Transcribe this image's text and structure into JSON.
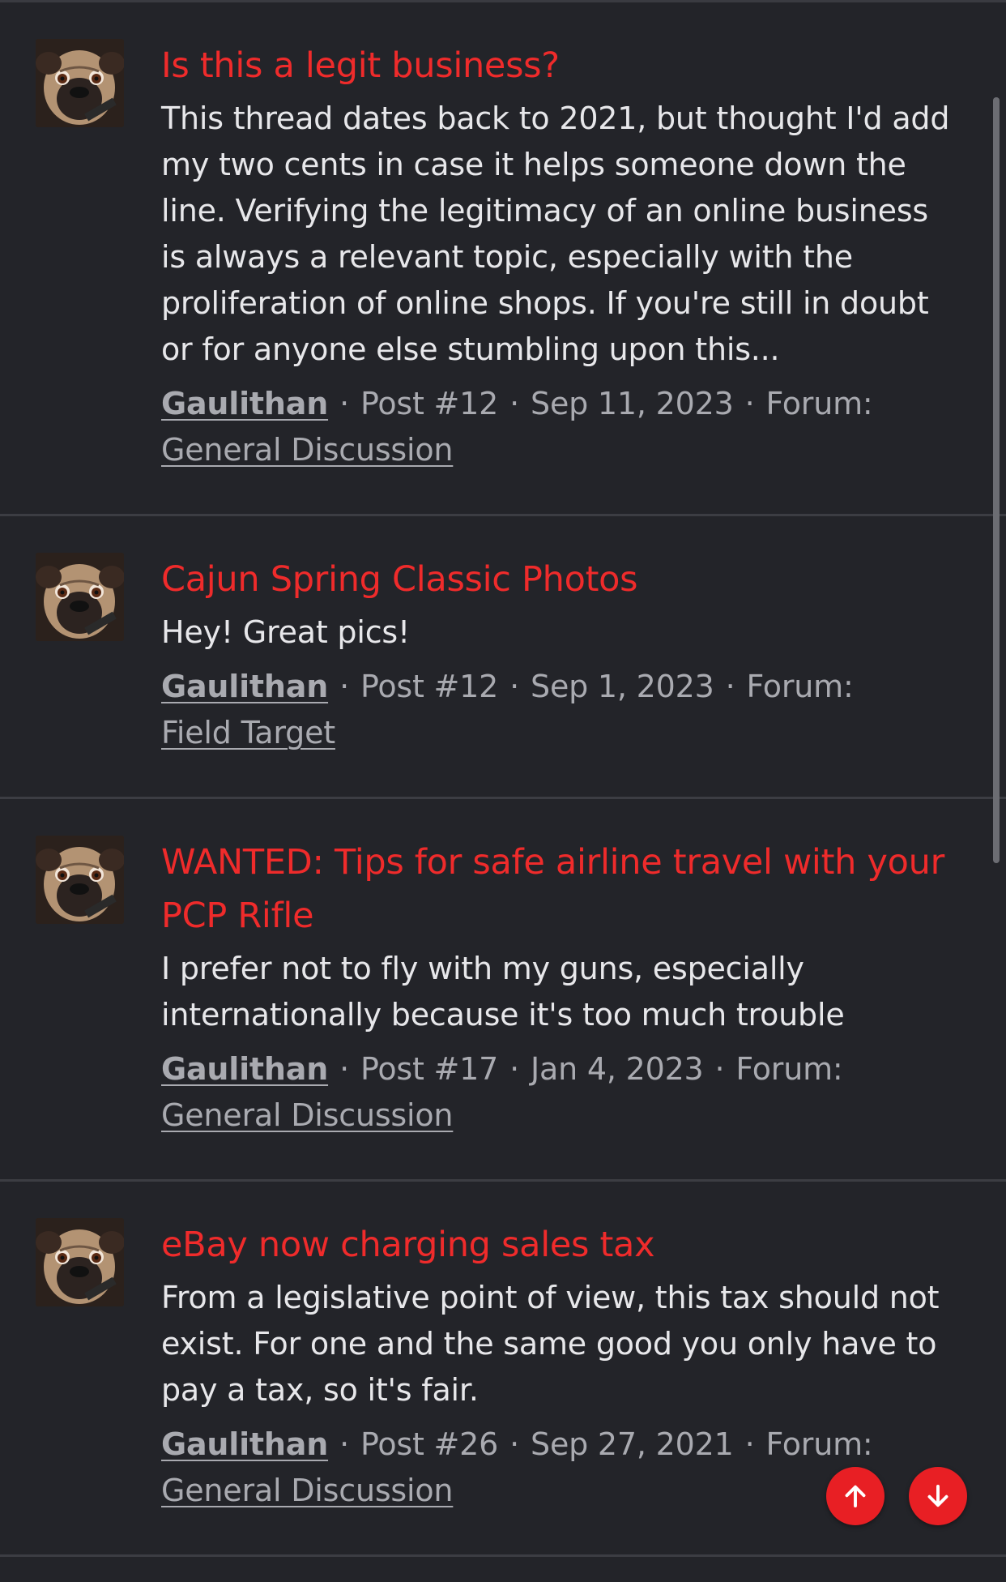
{
  "results": [
    {
      "title": "Is this a legit business?",
      "snippet": "This thread dates back to 2021, but thought I'd add my two cents in case it helps someone down the line. Verifying the legitimacy of an online business is always a relevant topic, especially with the proliferation of online shops. If you're still in doubt or for anyone else stumbling upon this...",
      "author": "Gaulithan",
      "post": "Post #12",
      "date": "Sep 11, 2023",
      "forum_label": "Forum:",
      "forum": "General Discussion"
    },
    {
      "title": "Cajun Spring Classic Photos",
      "snippet": "Hey! Great pics!",
      "author": "Gaulithan",
      "post": "Post #12",
      "date": "Sep 1, 2023",
      "forum_label": "Forum:",
      "forum": "Field Target"
    },
    {
      "title": "WANTED: Tips for safe airline travel with your PCP Rifle",
      "snippet": "I prefer not to fly with my guns, especially internationally because it's too much trouble",
      "author": "Gaulithan",
      "post": "Post #17",
      "date": "Jan 4, 2023",
      "forum_label": "Forum:",
      "forum": "General Discussion"
    },
    {
      "title": "eBay now charging sales tax",
      "snippet": "From a legislative point of view, this tax should not exist. For one and the same good you only have to pay a tax, so it's fair.",
      "author": "Gaulithan",
      "post": "Post #26",
      "date": "Sep 27, 2021",
      "forum_label": "Forum:",
      "forum": "General Discussion"
    }
  ],
  "separator": "·",
  "icons": {
    "avatar": "pug-avatar",
    "scroll_up": "arrow-up-icon",
    "scroll_down": "arrow-down-icon"
  },
  "colors": {
    "background": "#232429",
    "title": "#ef2b2b",
    "fab": "#e81f24",
    "meta": "#a9aab0"
  }
}
